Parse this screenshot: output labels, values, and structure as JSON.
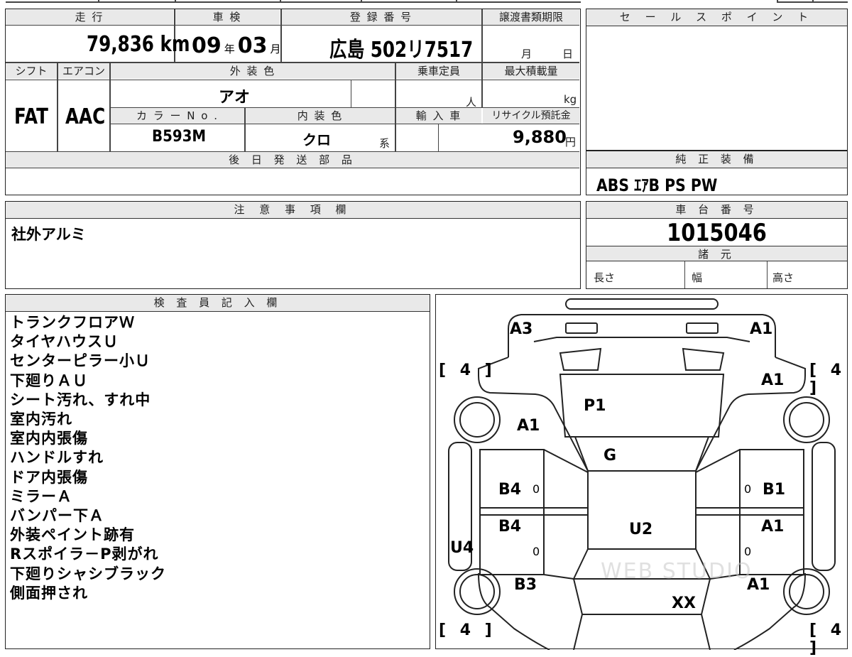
{
  "vehicle": {
    "mileage_label": "走 行",
    "mileage_value": "79,836 km",
    "shaken_label": "車 検",
    "shaken_year": "09",
    "shaken_year_unit": "年",
    "shaken_month": "03",
    "shaken_month_unit": "月",
    "registration_label": "登 録 番 号",
    "registration_value": "広島 502リ7517",
    "transfer_label": "譲渡書類期限",
    "transfer_month_unit": "月",
    "transfer_day_unit": "日",
    "shift_label": "シフト",
    "shift_value": "FAT",
    "aircon_label": "エアコン",
    "aircon_value": "AAC",
    "exterior_color_label": "外 装 色",
    "exterior_color_value": "アオ",
    "capacity_label": "乗車定員",
    "capacity_unit": "人",
    "max_load_label": "最大積載量",
    "max_load_unit": "kg",
    "color_no_label": "カ ラ ー N o .",
    "color_no_value": "B593M",
    "interior_color_label": "内 装 色",
    "interior_color_value": "クロ",
    "interior_suffix": "系",
    "import_label": "輸 入 車",
    "recycle_label": "リサイクル預託金",
    "recycle_value": "9,880",
    "recycle_unit": "円",
    "later_parts_label": "後 日 発 送 部 品"
  },
  "sales_point": {
    "label": "セ ー ル ス ポ イ ン ト"
  },
  "standard_equipment": {
    "label": "純 正 装 備",
    "value": "ABS ｴｱB PS PW"
  },
  "notes": {
    "label": "注 意 事 項 欄",
    "value": "社外アルミ"
  },
  "chassis": {
    "label": "車 台 番 号",
    "value": "1015046",
    "spec_label": "諸 元",
    "length_label": "長さ",
    "width_label": "幅",
    "height_label": "高さ"
  },
  "inspector": {
    "label": "検 査 員 記 入 欄",
    "lines": [
      "トランクフロアＷ",
      "タイヤハウスＵ",
      "センターピラー小Ｕ",
      "下廻りＡＵ",
      "シート汚れ、すれ中",
      "室内汚れ",
      "室内内張傷",
      "ハンドルすれ",
      "ドア内張傷",
      "ミラーＡ",
      "バンパー下Ａ",
      "外装ペイント跡有",
      "Rスポイラ－P剥がれ",
      "下廻りシャシブラック",
      "側面押され"
    ]
  },
  "diagram": {
    "marks": {
      "a3_left": "A3",
      "a1_top_right": "A1",
      "tire_tl": "[ 4 ]",
      "tire_tr": "[ 4 ]",
      "a1_right_front": "A1",
      "p1": "P1",
      "a1_left": "A1",
      "g": "G",
      "b4_upper": "B4",
      "b1": "B1",
      "b4_lower": "B4",
      "u2": "U2",
      "a1_right_mid": "A1",
      "u4": "U4",
      "b3": "B3",
      "a1_right_low": "A1",
      "xx": "XX",
      "tire_bl": "[ 4 ]",
      "tire_br": "[ 4 ]",
      "zero_1": "0",
      "zero_2": "0",
      "zero_3": "0",
      "zero_4": "0"
    },
    "watermark": "WEB STUDIO"
  }
}
